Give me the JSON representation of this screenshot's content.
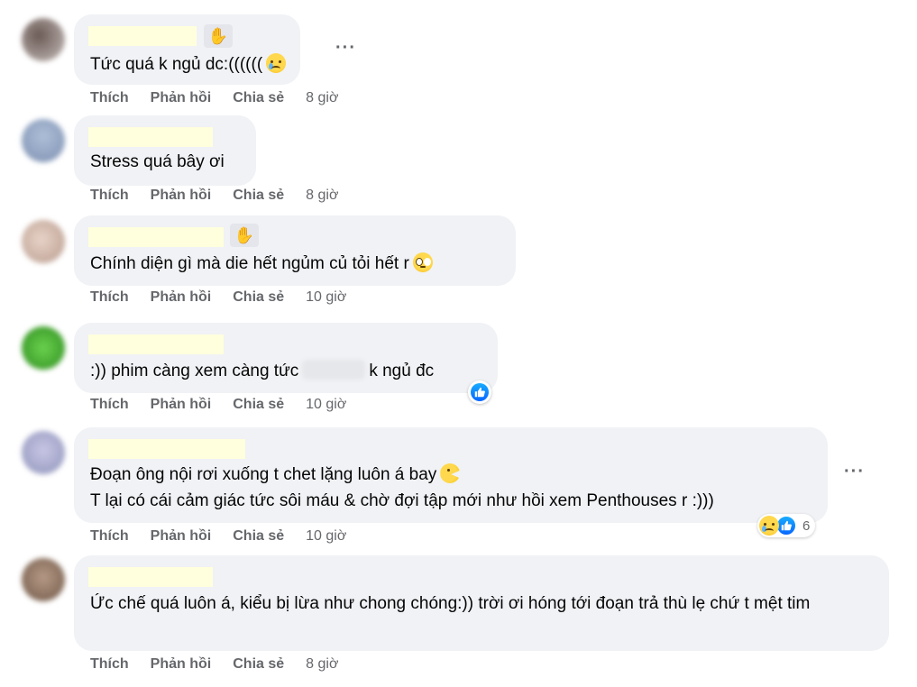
{
  "actions": {
    "like": "Thích",
    "reply": "Phản hồi",
    "share": "Chia sẻ"
  },
  "more_icon": "more-options-icon",
  "comments": [
    {
      "text": "Tức quá k ngủ dc:((((((",
      "time": "8 giờ",
      "emoji": "crying-face"
    },
    {
      "text": "Stress quá bây ơi",
      "time": "8 giờ"
    },
    {
      "text": "Chính diện gì mà die hết ngủm củ tỏi hết r",
      "time": "10 giờ",
      "emoji": "pleading-face"
    },
    {
      "text_before": ":)) phim càng xem càng tức",
      "text_after": "k ngủ đc",
      "time": "10 giờ",
      "reaction": "like"
    },
    {
      "line1": "Đoạn ông nội rơi xuống t chet lặng luôn á bay",
      "line2": "T lại có cái cảm giác tức sôi máu & chờ đợi tập mới như hồi xem Penthouses r :)))",
      "time": "10 giờ",
      "reaction_count": "6",
      "emoji": "moon-face"
    },
    {
      "text": "Ức chế quá luôn á, kiểu bị lừa như chong chóng:)) trời ơi hóng tới đoạn trả thù lẹ chứ t mệt tim",
      "time": "8 giờ"
    }
  ]
}
